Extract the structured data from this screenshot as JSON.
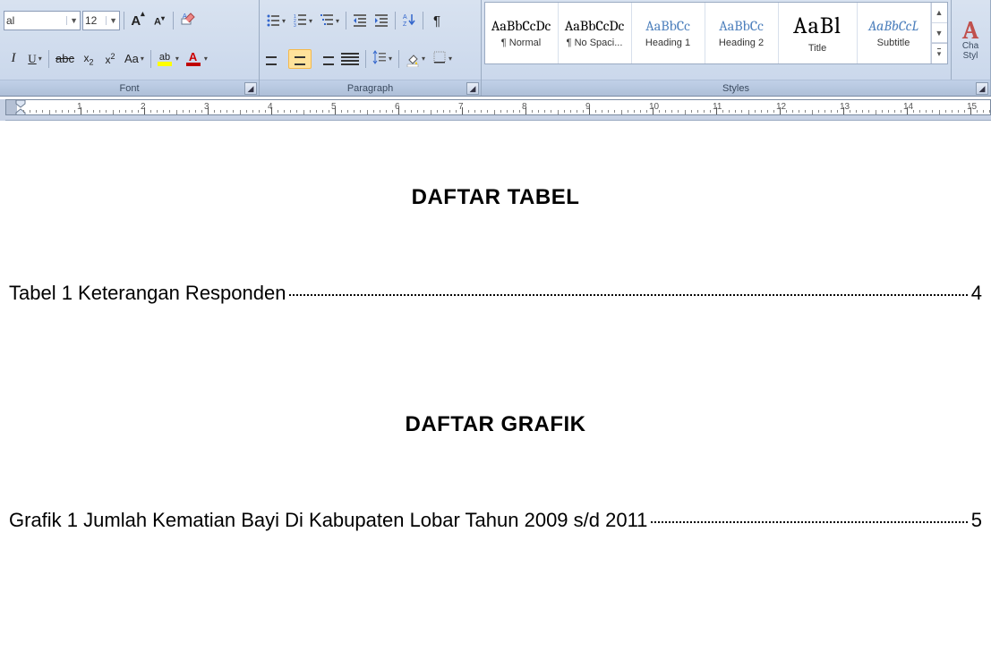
{
  "font": {
    "family_value": "al",
    "size_value": "12",
    "grow": "A",
    "shrink": "A",
    "italic": "I",
    "underline": "U",
    "strike": "abc",
    "sub_base": "x",
    "sub_idx": "2",
    "sup_base": "x",
    "sup_idx": "2",
    "case": "Aa",
    "highlight_letters": "ab",
    "font_color_letter": "A",
    "group_label": "Font"
  },
  "paragraph": {
    "sort_a": "A",
    "sort_z": "Z",
    "pilcrow": "¶",
    "group_label": "Paragraph"
  },
  "styles": {
    "items": [
      {
        "preview": "AaBbCcDc",
        "label": "¶ Normal",
        "cls": ""
      },
      {
        "preview": "AaBbCcDc",
        "label": "¶ No Spaci...",
        "cls": ""
      },
      {
        "preview": "AaBbCc",
        "label": "Heading 1",
        "cls": "blue"
      },
      {
        "preview": "AaBbCc",
        "label": "Heading 2",
        "cls": "blue"
      },
      {
        "preview": "AaBl",
        "label": "Title",
        "cls": "big"
      },
      {
        "preview": "AaBbCcL",
        "label": "Subtitle",
        "cls": "ital"
      }
    ],
    "change_big": "A",
    "change_line1": "Cha",
    "change_line2": "Styl",
    "group_label": "Styles"
  },
  "ruler": {
    "numbers": [
      "1",
      "2",
      "3",
      "4",
      "5",
      "6",
      "7",
      "8",
      "9",
      "10",
      "11",
      "12",
      "13",
      "14",
      "15"
    ]
  },
  "document": {
    "heading1": "DAFTAR TABEL",
    "entry1_text": "Tabel 1 Keterangan Responden",
    "entry1_page": "4",
    "heading2": "DAFTAR GRAFIK",
    "entry2_text": "Grafik 1 Jumlah Kematian Bayi Di Kabupaten Lobar Tahun 2009 s/d 2011",
    "entry2_page": "5"
  }
}
